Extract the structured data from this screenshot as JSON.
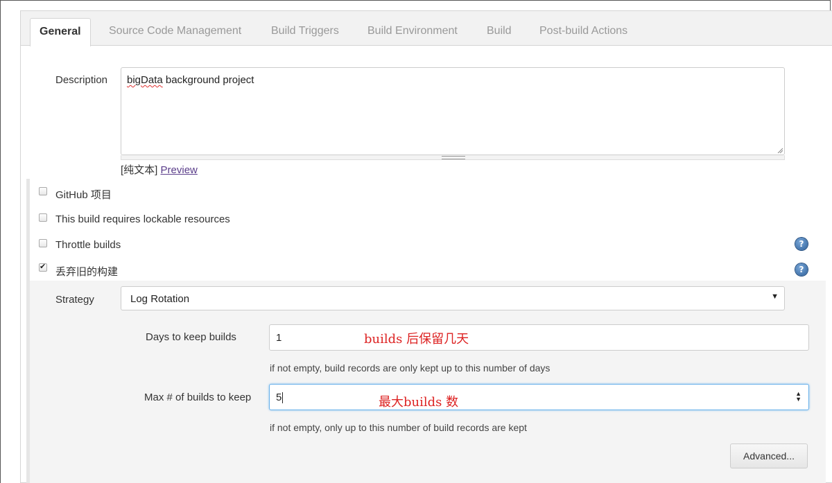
{
  "tabs": [
    {
      "label": "General",
      "active": true
    },
    {
      "label": "Source Code Management"
    },
    {
      "label": "Build Triggers"
    },
    {
      "label": "Build Environment"
    },
    {
      "label": "Build"
    },
    {
      "label": "Post-build Actions"
    }
  ],
  "description": {
    "label": "Description",
    "value_word1": "bigData",
    "value_rest": " background project",
    "format_text": "[纯文本]",
    "preview_link": "Preview"
  },
  "options": [
    {
      "label": "GitHub 项目",
      "checked": false
    },
    {
      "label": "This build requires lockable resources",
      "checked": false
    },
    {
      "label": "Throttle builds",
      "checked": false,
      "has_help": true
    },
    {
      "label": "丢弃旧的构建",
      "checked": true,
      "has_help": true
    }
  ],
  "help_icon": "?",
  "discard": {
    "strategy_label": "Strategy",
    "strategy_value": "Log Rotation",
    "days_label": "Days to keep builds",
    "days_value": "1",
    "days_annotation": "builds 后保留几天",
    "days_hint": "if not empty, build records are only kept up to this number of days",
    "max_label": "Max # of builds to keep",
    "max_value": "5",
    "max_annotation": "最大builds 数",
    "max_hint": "if not empty, only up to this number of build records are kept",
    "advanced_button": "Advanced..."
  },
  "colors": {
    "annotation": "#dd2222",
    "link": "#5a3d8a",
    "focus_border": "#66afe9"
  }
}
